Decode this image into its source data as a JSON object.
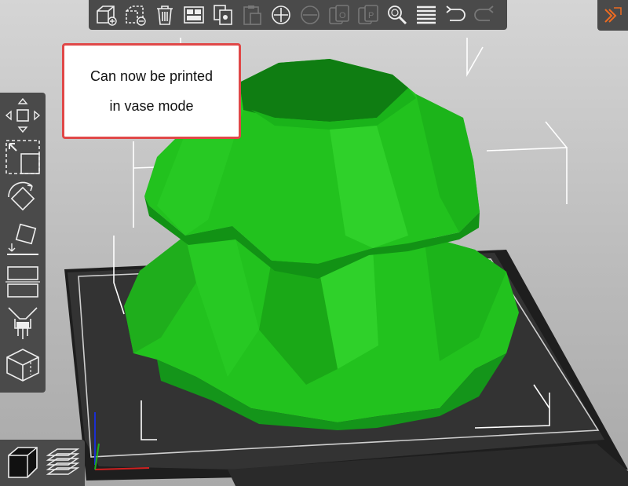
{
  "callout": {
    "line1": "Can now be printed",
    "line2": "in vase mode"
  },
  "top_toolbar": {
    "buttons": [
      "add-icon",
      "delete-icon",
      "delete-all-icon",
      "arrange-icon",
      "copy-icon",
      "paste-icon",
      "add-instance-icon",
      "remove-instance-icon",
      "split-to-objects-icon",
      "split-to-parts-icon",
      "search-icon",
      "layers-editing-icon",
      "undo-icon",
      "redo-icon"
    ]
  },
  "left_toolbar": {
    "buttons": [
      "move-icon",
      "scale-icon",
      "rotate-icon",
      "place-on-face-icon",
      "cut-icon",
      "paint-supports-icon",
      "seam-painting-icon"
    ]
  },
  "view_switch": [
    "3d-view-icon",
    "preview-icon"
  ],
  "colors": {
    "model_green": "#22c21e",
    "bed_dark": "#2b2b2b",
    "toolbar_bg": "#4a4a4a",
    "accent_orange": "#ed6b21",
    "callout_border": "#e04848"
  }
}
